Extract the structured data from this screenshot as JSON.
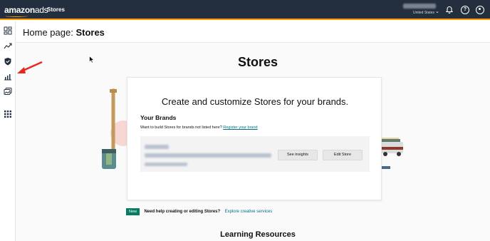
{
  "topbar": {
    "logo_main": "amazon",
    "logo_suffix": "ads",
    "nav_stores": "Stores",
    "account_country": "United States",
    "help_glyph": "?",
    "icons": [
      "bell-icon",
      "help-icon",
      "user-icon"
    ],
    "bg_color": "#232f3e",
    "accent_color": "#ff9900"
  },
  "sidebar": {
    "items": [
      "dashboard-icon",
      "trend-chart-icon",
      "shield-icon",
      "bar-chart-icon",
      "media-icon",
      "apps-grid-icon"
    ]
  },
  "header": {
    "title_prefix": "Home page:",
    "title_bold": "Stores"
  },
  "main": {
    "hero_title": "Stores",
    "card": {
      "title": "Create and customize Stores for your brands.",
      "brands_heading": "Your Brands",
      "brands_sub": "Want to build Stores for brands not listed here?",
      "register_link": "Register your brand",
      "see_insights_label": "See insights",
      "edit_store_label": "Edit Store"
    },
    "help": {
      "badge": "New",
      "text": "Need help creating or editing Stores?",
      "link": "Explore creative services"
    },
    "learning_title": "Learning Resources"
  }
}
